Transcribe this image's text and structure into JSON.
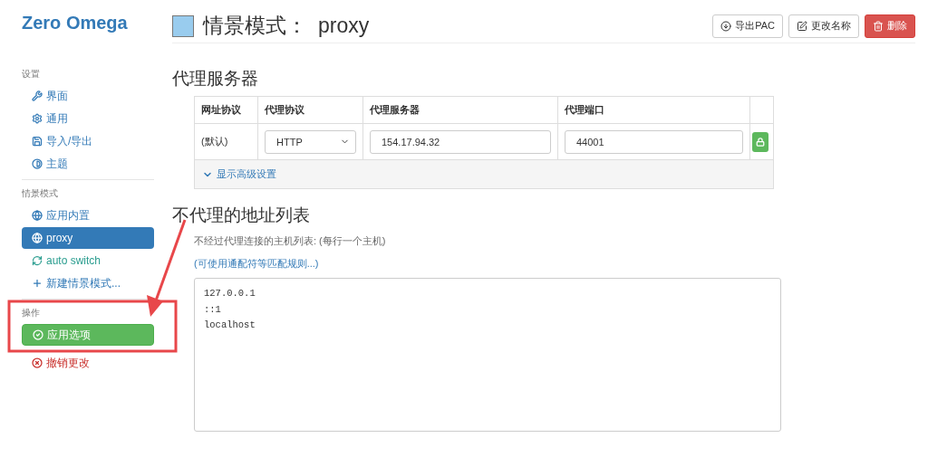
{
  "app_title": "Zero Omega",
  "sidebar": [
    {
      "heading": "设置",
      "items": [
        {
          "label": "界面",
          "kind": "wrench",
          "selected": false
        },
        {
          "label": "通用",
          "kind": "gear",
          "selected": false
        },
        {
          "label": "导入/导出",
          "kind": "floppy",
          "selected": false
        },
        {
          "label": "主题",
          "kind": "contrast",
          "selected": false
        }
      ]
    },
    {
      "heading": "情景模式",
      "items": [
        {
          "label": "应用内置",
          "kind": "globe",
          "selected": false
        },
        {
          "label": "proxy",
          "kind": "globe",
          "selected": true
        },
        {
          "label": "auto switch",
          "kind": "switch",
          "selected": false
        },
        {
          "label": "新建情景模式...",
          "kind": "plus",
          "selected": false
        }
      ]
    },
    {
      "heading": "操作",
      "items": [
        {
          "label": "应用选项",
          "kind": "apply",
          "selected": false
        },
        {
          "label": "撤销更改",
          "kind": "discard",
          "selected": false
        }
      ]
    }
  ],
  "header": {
    "title": "情景模式：",
    "profile": "proxy",
    "color": "#99ccee",
    "buttons": [
      {
        "label": "导出PAC",
        "kind": "export"
      },
      {
        "label": "更改名称",
        "kind": "rename"
      },
      {
        "label": "删除",
        "kind": "delete"
      }
    ]
  },
  "proxy_section": {
    "title": "代理服务器",
    "columns": [
      "网址协议",
      "代理协议",
      "代理服务器",
      "代理端口"
    ],
    "rows": [
      {
        "scheme": "(默认)",
        "protocol": "HTTP",
        "server": "154.17.94.32",
        "port": "44001"
      }
    ],
    "advanced_link": "显示高级设置"
  },
  "bypass_section": {
    "title": "不代理的地址列表",
    "description": "不经过代理连接的主机列表: (每行一个主机)",
    "link": "(可使用通配符等匹配规则...)",
    "hosts": [
      "127.0.0.1",
      "::1",
      "localhost"
    ]
  },
  "annotation": {
    "kind": "box-arrow"
  }
}
